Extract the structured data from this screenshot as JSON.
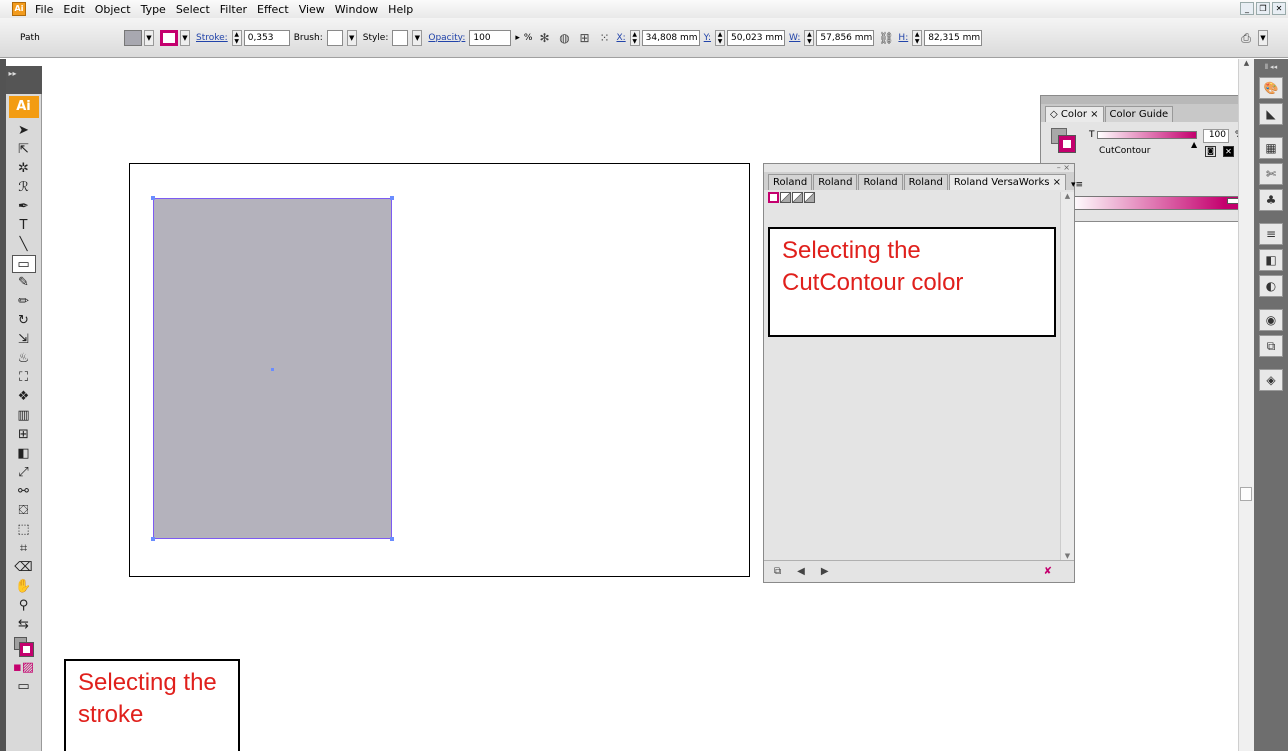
{
  "menubar": {
    "items": [
      "File",
      "Edit",
      "Object",
      "Type",
      "Select",
      "Filter",
      "Effect",
      "View",
      "Window",
      "Help"
    ]
  },
  "controlbar": {
    "selection_type": "Path",
    "stroke_label": "Stroke:",
    "stroke_weight": "0,353",
    "brush_label": "Brush:",
    "style_label": "Style:",
    "opacity_label": "Opacity:",
    "opacity_value": "100",
    "opacity_unit": "%",
    "x_label": "X:",
    "x_value": "34,808 mm",
    "y_label": "Y:",
    "y_value": "50,023 mm",
    "w_label": "W:",
    "w_value": "57,856 mm",
    "h_label": "H:",
    "h_value": "82,315 mm"
  },
  "toolbox": {
    "logo": "Ai"
  },
  "color_panel": {
    "tabs": [
      "Color",
      "Color Guide"
    ],
    "tint_label": "T",
    "tint_value": "100",
    "tint_unit": "%",
    "swatch_name": "CutContour",
    "accent_color": "#c4006e"
  },
  "roland_panel": {
    "tabs": [
      "Roland",
      "Roland",
      "Roland",
      "Roland",
      "Roland VersaWorks"
    ]
  },
  "annotations": {
    "cutcontour_note": "Selecting the CutContour color",
    "stroke_note": "Selecting the stroke"
  }
}
